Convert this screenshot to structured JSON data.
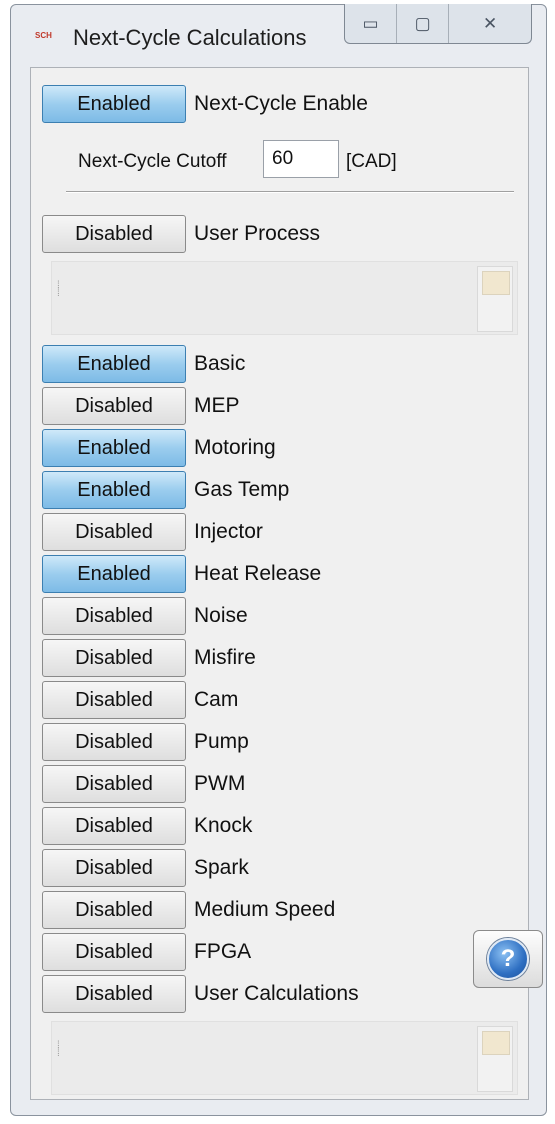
{
  "window": {
    "title": "Next-Cycle Calculations",
    "logo_text": "SCH",
    "minimize_glyph": "▭",
    "maximize_glyph": "▢",
    "close_glyph": "✕"
  },
  "next_cycle": {
    "enable_state": "Enabled",
    "enable_label": "Next-Cycle Enable",
    "cutoff_label": "Next-Cycle Cutoff",
    "cutoff_value": "60",
    "cutoff_unit": "[CAD]"
  },
  "user_process": {
    "state": "Disabled",
    "label": "User Process"
  },
  "calculations": [
    {
      "state": "Enabled",
      "label": "Basic"
    },
    {
      "state": "Disabled",
      "label": "MEP"
    },
    {
      "state": "Enabled",
      "label": "Motoring"
    },
    {
      "state": "Enabled",
      "label": "Gas Temp"
    },
    {
      "state": "Disabled",
      "label": "Injector"
    },
    {
      "state": "Enabled",
      "label": "Heat Release"
    },
    {
      "state": "Disabled",
      "label": "Noise"
    },
    {
      "state": "Disabled",
      "label": "Misfire"
    },
    {
      "state": "Disabled",
      "label": "Cam"
    },
    {
      "state": "Disabled",
      "label": "Pump"
    },
    {
      "state": "Disabled",
      "label": "PWM"
    },
    {
      "state": "Disabled",
      "label": "Knock"
    },
    {
      "state": "Disabled",
      "label": "Spark"
    },
    {
      "state": "Disabled",
      "label": "Medium Speed"
    },
    {
      "state": "Disabled",
      "label": "FPGA"
    },
    {
      "state": "Disabled",
      "label": "User Calculations"
    }
  ],
  "help": {
    "glyph": "?"
  },
  "icons": {
    "help": "help-question-icon",
    "grip": "drag-grip-icon"
  }
}
